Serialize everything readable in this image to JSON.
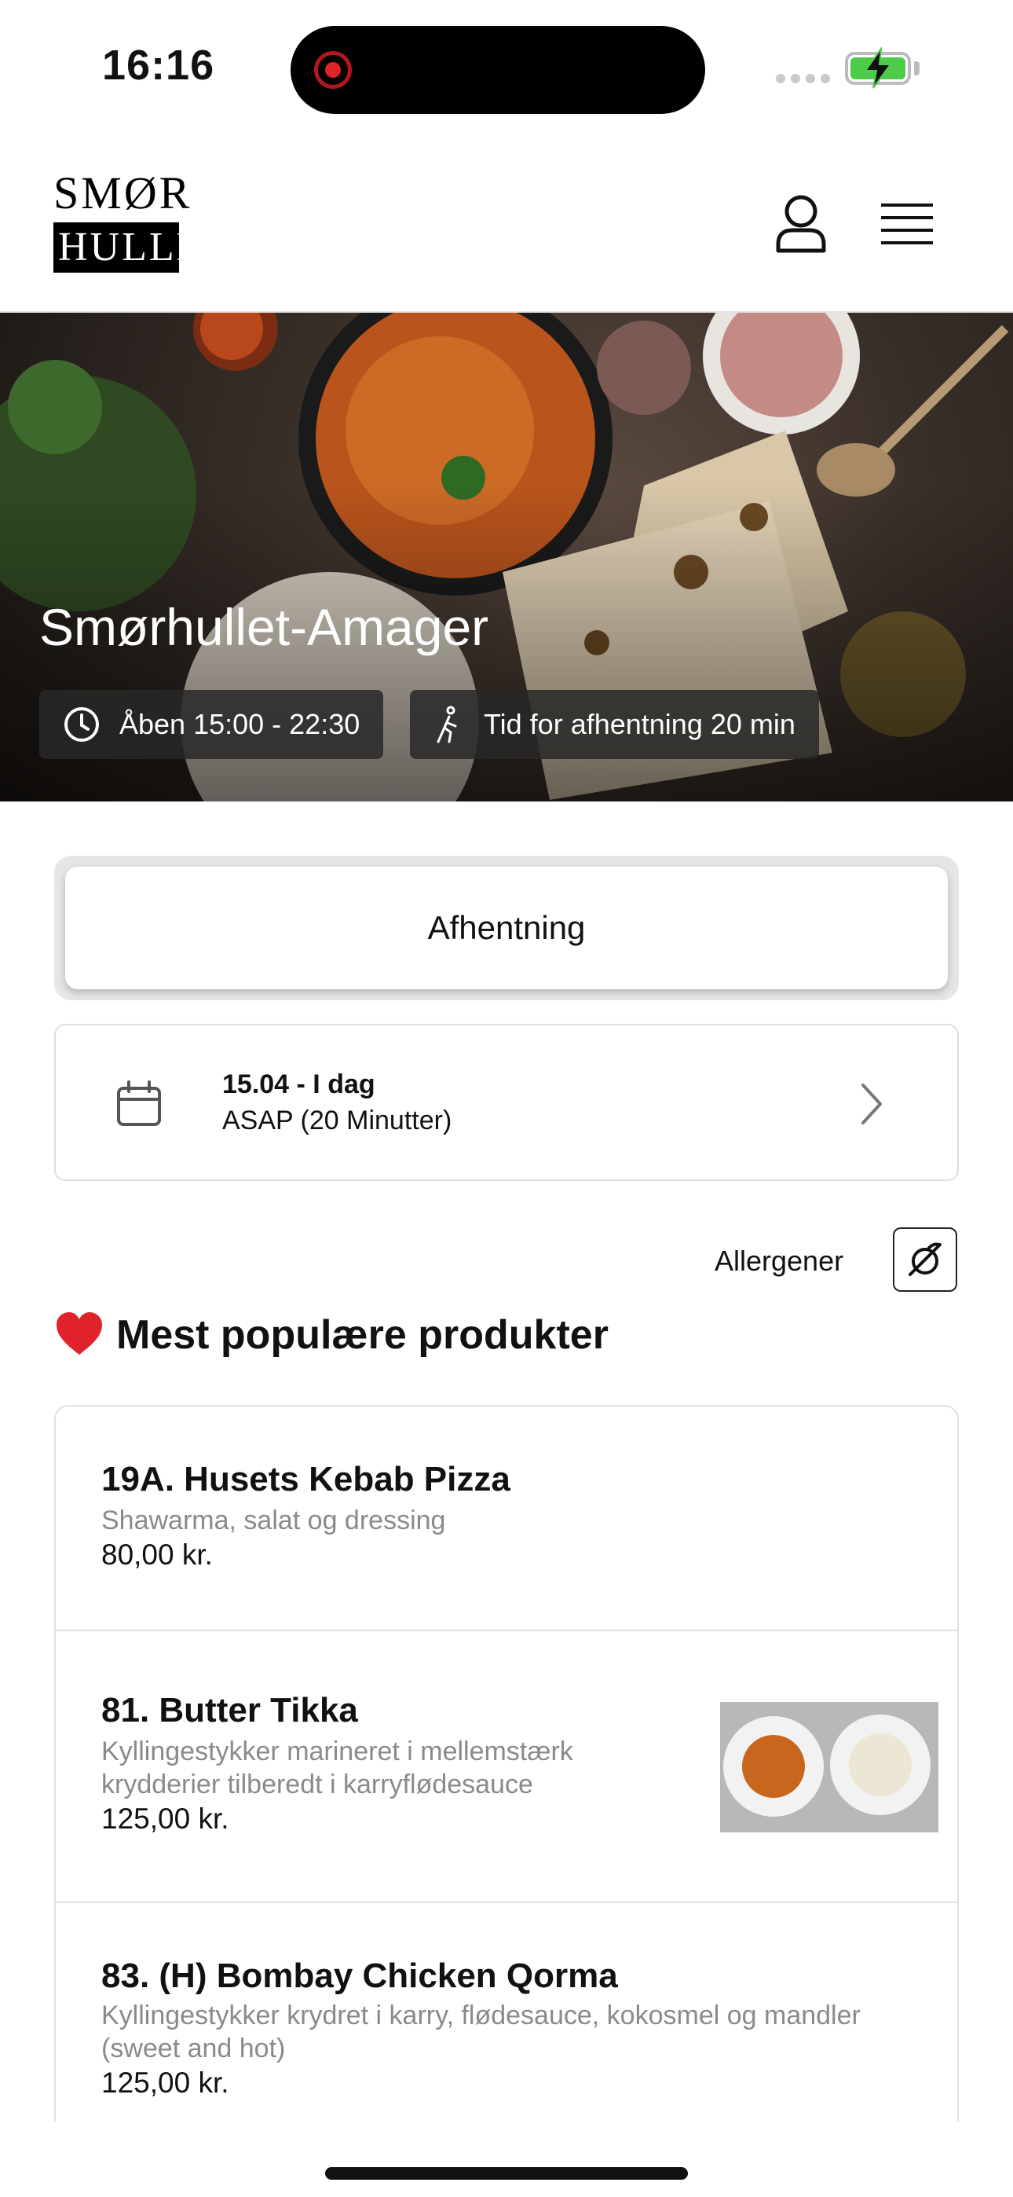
{
  "status_bar": {
    "time": "16:16"
  },
  "header": {
    "logo_top": "SMØR",
    "logo_bottom": "HULLET",
    "account_icon": "user-icon",
    "menu_icon": "hamburger-menu-icon"
  },
  "hero": {
    "title": "Smørhullet-Amager",
    "open_hours": "Åben 15:00 - 22:30",
    "pickup_time": "Tid for afhentning 20 min"
  },
  "order_type": {
    "label": "Afhentning"
  },
  "schedule": {
    "date_label": "15.04 - I dag",
    "time_label": "ASAP (20 Minutter)"
  },
  "allergens": {
    "label": "Allergener"
  },
  "popular": {
    "title": "Mest populære produkter",
    "products": [
      {
        "name": "19A. Husets Kebab Pizza",
        "description": "Shawarma, salat og dressing",
        "price": "80,00 kr."
      },
      {
        "name": "81. Butter Tikka",
        "description": "Kyllingestykker marineret i mellemstærk krydderier tilberedt i karryflødesauce",
        "price": "125,00 kr."
      },
      {
        "name": "83. (H) Bombay Chicken Qorma",
        "description": "Kyllingestykker krydret i karry, flødesauce, kokosmel og mandler (sweet and hot)",
        "price": "125,00 kr."
      }
    ]
  },
  "colors": {
    "accent": "#111111",
    "heart": "#e0232b",
    "battery": "#4fcb4a"
  }
}
